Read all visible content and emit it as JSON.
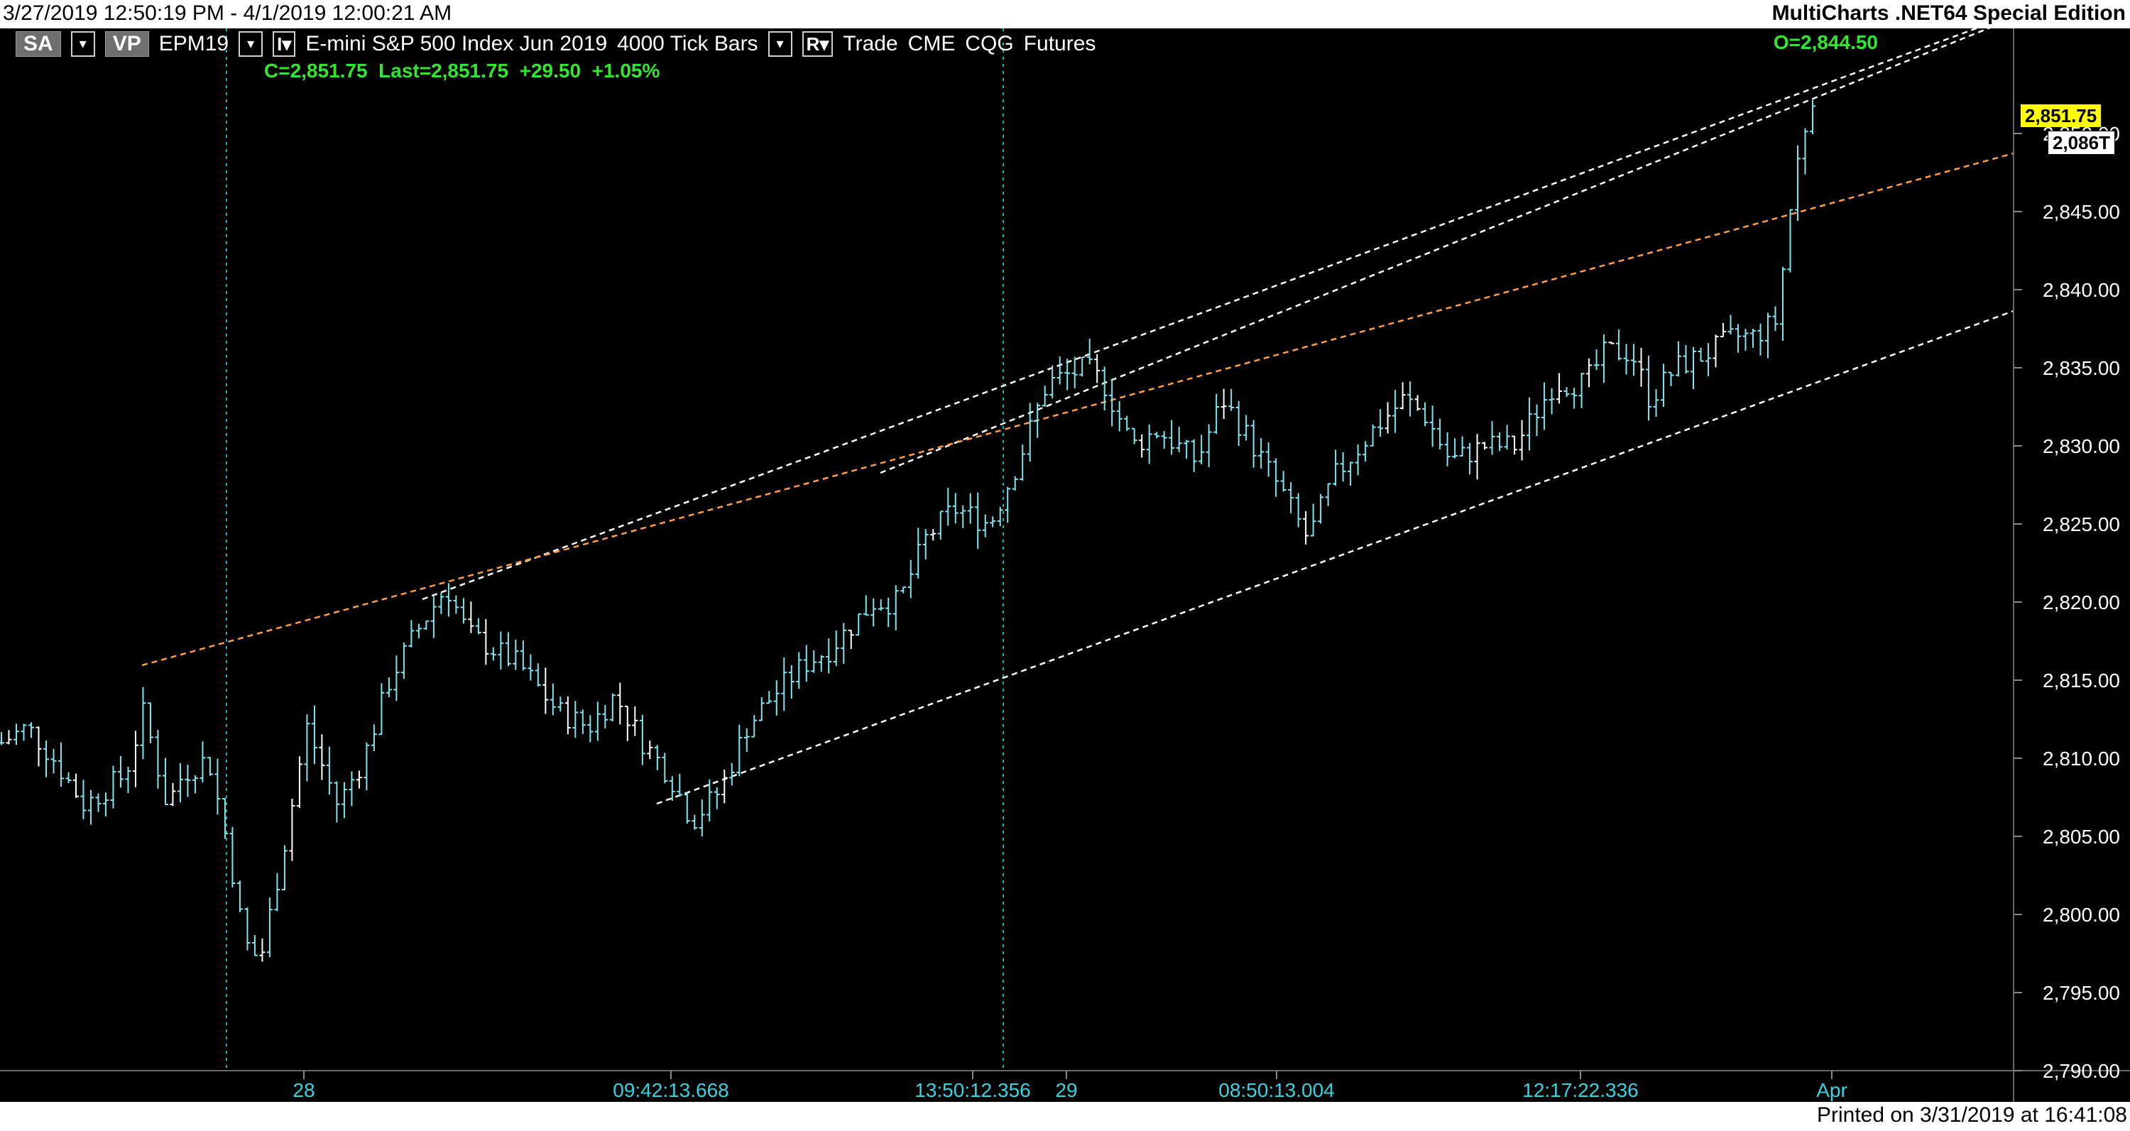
{
  "window": {
    "date_range": "3/27/2019 12:50:19 PM - 4/1/2019 12:00:21 AM",
    "app_name": "MultiCharts .NET64 Special Edition",
    "printed_on": "Printed on 3/31/2019 at 16:41:08"
  },
  "toolbar": {
    "sa_label": "SA",
    "vp_label": "VP",
    "symbol": "EPM19",
    "interval_button": "I",
    "description": "E-mini S&P 500 Index Jun 2019",
    "bar_type": "4000 Tick Bars",
    "r_button": "R",
    "mode": "Trade",
    "exchange": "CME",
    "feed": "CQG",
    "category": "Futures"
  },
  "quote": {
    "close": "C=2,851.75",
    "last": "Last=2,851.75",
    "change": "+29.50",
    "change_pct": "+1.05%",
    "open": "O=2,844.50"
  },
  "price_axis": {
    "ticks": [
      "2,795.00",
      "2,800.00",
      "2,805.00",
      "2,810.00",
      "2,815.00",
      "2,820.00",
      "2,825.00",
      "2,830.00",
      "2,835.00",
      "2,840.00",
      "2,845.00",
      "2,850.00",
      "2,790.00"
    ],
    "last_price_badge": "2,851.75",
    "tick_count_badge": "2,086T"
  },
  "time_axis": {
    "labels": [
      "28",
      "09:42:13.668",
      "13:50:12.356",
      "29",
      "08:50:13.004",
      "12:17:22.336",
      "Apr"
    ]
  },
  "colors": {
    "background": "#000000",
    "bars": "#7fe6f0",
    "bar_accent": "#ffffff",
    "axis_text": "#ffffff",
    "time_text": "#37d4e0",
    "quote_text": "#32e632",
    "trendline_white": "#ffffff",
    "trendline_orange": "#ff9e4a",
    "last_badge_bg": "#ffff00",
    "session_line": "#1ab3b3"
  },
  "chart_data": {
    "type": "ohlc",
    "y_range": [
      2789,
      2854
    ],
    "bars_count": 244,
    "control_points": [
      [
        0,
        2811
      ],
      [
        10,
        2812
      ],
      [
        20,
        2810
      ],
      [
        32,
        2807
      ],
      [
        40,
        2808
      ],
      [
        48,
        2809
      ],
      [
        55,
        2813
      ],
      [
        64,
        2807
      ],
      [
        70,
        2809
      ],
      [
        80,
        2810
      ],
      [
        88,
        2804
      ],
      [
        92,
        2800
      ],
      [
        95,
        2798
      ],
      [
        100,
        2797
      ],
      [
        110,
        2805
      ],
      [
        118,
        2812
      ],
      [
        130,
        2807
      ],
      [
        140,
        2810
      ],
      [
        150,
        2815
      ],
      [
        160,
        2818
      ],
      [
        172,
        2821
      ],
      [
        180,
        2818
      ],
      [
        190,
        2817
      ],
      [
        200,
        2816
      ],
      [
        215,
        2813
      ],
      [
        227,
        2812
      ],
      [
        237,
        2814
      ],
      [
        248,
        2811
      ],
      [
        258,
        2809
      ],
      [
        267,
        2806
      ],
      [
        278,
        2808
      ],
      [
        288,
        2812
      ],
      [
        298,
        2814
      ],
      [
        310,
        2816
      ],
      [
        320,
        2817
      ],
      [
        337,
        2820
      ],
      [
        347,
        2820
      ],
      [
        357,
        2824
      ],
      [
        368,
        2826
      ],
      [
        382,
        2825
      ],
      [
        393,
        2829
      ],
      [
        404,
        2834
      ],
      [
        419,
        2835
      ],
      [
        426,
        2834
      ],
      [
        437,
        2830
      ],
      [
        447,
        2831
      ],
      [
        462,
        2829
      ],
      [
        472,
        2833
      ],
      [
        480,
        2831
      ],
      [
        495,
        2827
      ],
      [
        505,
        2824
      ],
      [
        515,
        2828
      ],
      [
        530,
        2831
      ],
      [
        542,
        2833
      ],
      [
        550,
        2832
      ],
      [
        560,
        2829
      ],
      [
        573,
        2830
      ],
      [
        585,
        2830
      ],
      [
        600,
        2834
      ],
      [
        612,
        2834
      ],
      [
        620,
        2836
      ],
      [
        630,
        2836
      ],
      [
        637,
        2833
      ],
      [
        647,
        2835
      ],
      [
        660,
        2836
      ],
      [
        670,
        2837
      ],
      [
        677,
        2837
      ],
      [
        686,
        2838
      ],
      [
        692,
        2846
      ],
      [
        696,
        2850
      ],
      [
        700,
        2851.75
      ]
    ]
  }
}
